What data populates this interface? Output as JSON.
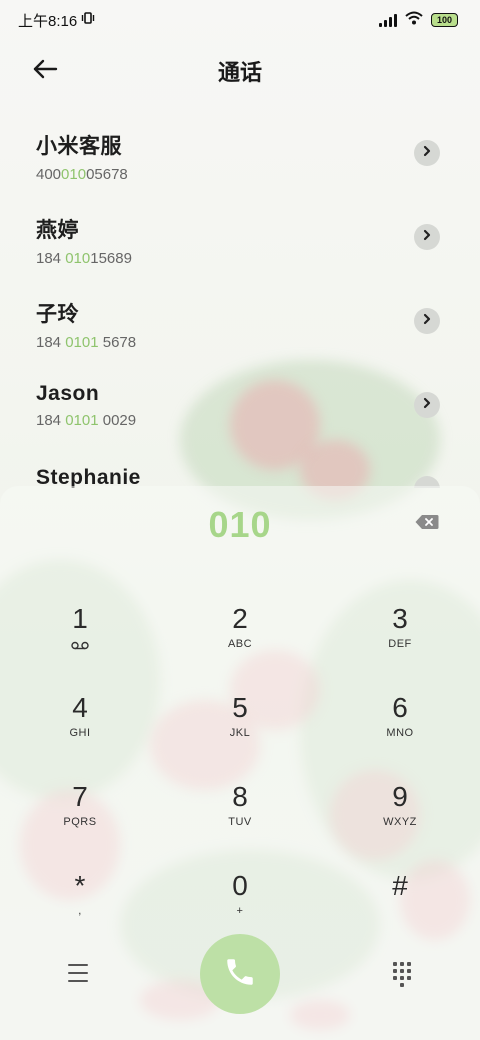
{
  "status_bar": {
    "time": "上午8:16",
    "battery": "100",
    "icons": [
      "vibrate-icon",
      "signal-icon",
      "wifi-icon",
      "battery-icon"
    ]
  },
  "header": {
    "title": "通话",
    "back_icon": "arrow-left-icon"
  },
  "contacts": [
    {
      "name": "小米客服",
      "number_pre": "400",
      "number_hl": "010",
      "number_post": "05678"
    },
    {
      "name": "燕婷",
      "number_pre": "184 ",
      "number_hl": "010",
      "number_post": "15689"
    },
    {
      "name": "子玲",
      "number_pre": "184 ",
      "number_hl": "0101",
      "number_post": " 5678"
    },
    {
      "name": "Jason",
      "number_pre": "184 ",
      "number_hl": "0101",
      "number_post": " 0029"
    },
    {
      "name": "Stephanie",
      "number_pre": "",
      "number_hl": "",
      "number_post": ""
    }
  ],
  "dialer": {
    "display": "010",
    "keys": [
      {
        "digit": "1",
        "letters": ""
      },
      {
        "digit": "2",
        "letters": "ABC"
      },
      {
        "digit": "3",
        "letters": "DEF"
      },
      {
        "digit": "4",
        "letters": "GHI"
      },
      {
        "digit": "5",
        "letters": "JKL"
      },
      {
        "digit": "6",
        "letters": "MNO"
      },
      {
        "digit": "7",
        "letters": "PQRS"
      },
      {
        "digit": "8",
        "letters": "TUV"
      },
      {
        "digit": "9",
        "letters": "WXYZ"
      },
      {
        "digit": "*",
        "letters": ","
      },
      {
        "digit": "0",
        "letters": "+"
      },
      {
        "digit": "#",
        "letters": ""
      }
    ]
  },
  "colors": {
    "accent": "#a7d68a",
    "highlight": "#8fc46d",
    "call_button": "#bde0a6"
  }
}
